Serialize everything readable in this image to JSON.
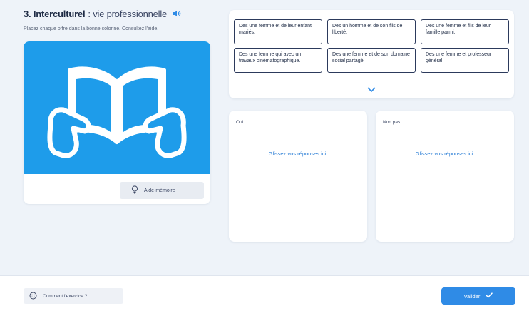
{
  "exercise": {
    "title_strong": "3. Interculturel",
    "title_rest": ": vie professionnelle",
    "instruction": "Placez chaque offre dans la bonne colonne. Consultez l'aide.",
    "help_label": "Aide-mémoire",
    "audio_icon": "speaker-icon"
  },
  "bank": {
    "items": [
      "Des une femme et de leur enfant mariés.",
      "Des un homme et de son fils de liberté.",
      "Des une femme et fils de leur famille parmi.",
      "Des une femme qui avec un travaux cinématographique.",
      "Des une femme et de son domaine social partagé.",
      "Des une femme et professeur général."
    ],
    "expand_icon": "chevron-down-icon"
  },
  "zones": [
    {
      "label": "Oui",
      "hint": "Glissez vos réponses ici."
    },
    {
      "label": "Non pas",
      "hint": "Glissez vos réponses ici."
    }
  ],
  "footer": {
    "feedback_label": "Comment l'exercice ?",
    "validate_label": "Valider"
  },
  "colors": {
    "accent": "#2f8be6",
    "illustration_bg": "#1e9cea",
    "zone_hint": "#2c7fd6",
    "chip_border": "#2c3a5c"
  }
}
